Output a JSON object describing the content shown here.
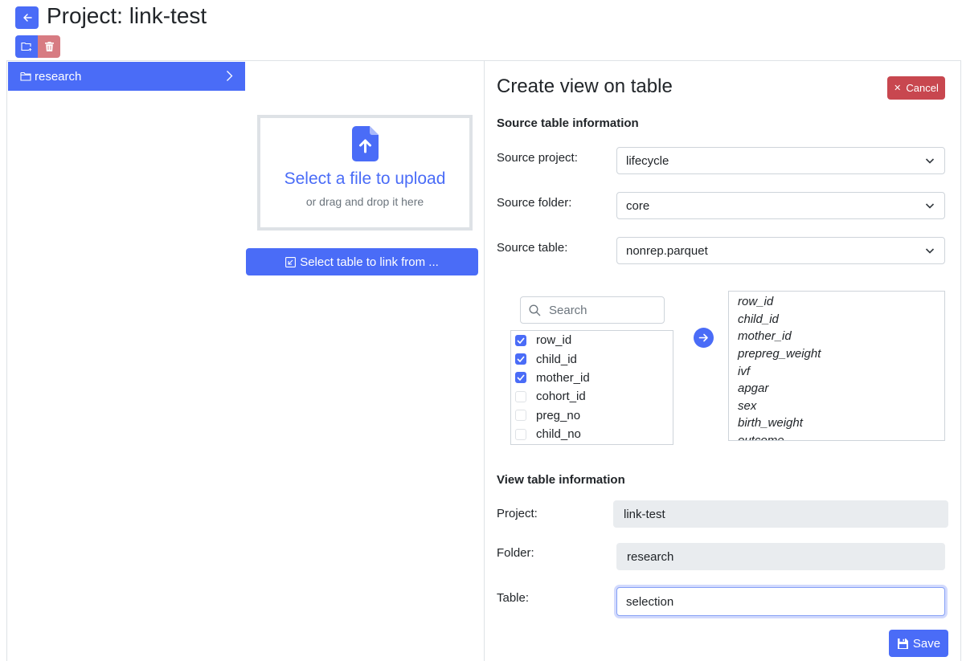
{
  "header": {
    "title": "Project: link-test"
  },
  "sidebar": {
    "folders": [
      {
        "label": "research",
        "icon": "folder-icon"
      }
    ]
  },
  "upload": {
    "title": "Select a file to upload",
    "subtitle": "or drag and drop it here",
    "link_button": "Select table to link from ..."
  },
  "panel": {
    "title": "Create view on table",
    "cancel_label": "Cancel",
    "source_section_title": "Source table information",
    "source_project_label": "Source project:",
    "source_project_value": "lifecycle",
    "source_folder_label": "Source folder:",
    "source_folder_value": "core",
    "source_table_label": "Source table:",
    "source_table_value": "nonrep.parquet",
    "search_placeholder": "Search",
    "columns_checklist": [
      {
        "name": "row_id",
        "checked": true
      },
      {
        "name": "child_id",
        "checked": true
      },
      {
        "name": "mother_id",
        "checked": true
      },
      {
        "name": "cohort_id",
        "checked": false
      },
      {
        "name": "preg_no",
        "checked": false
      },
      {
        "name": "child_no",
        "checked": false
      }
    ],
    "all_columns": [
      "row_id",
      "child_id",
      "mother_id",
      "prepreg_weight",
      "ivf",
      "apgar",
      "sex",
      "birth_weight",
      "outcome"
    ],
    "view_section_title": "View table information",
    "project_label": "Project:",
    "project_value": "link-test",
    "folder_label": "Folder:",
    "folder_value": "research",
    "table_label": "Table:",
    "table_value": "selection",
    "save_label": "Save"
  },
  "colors": {
    "primary": "#4a6cf7",
    "danger": "#c8474f",
    "danger_light": "#d77b82"
  }
}
